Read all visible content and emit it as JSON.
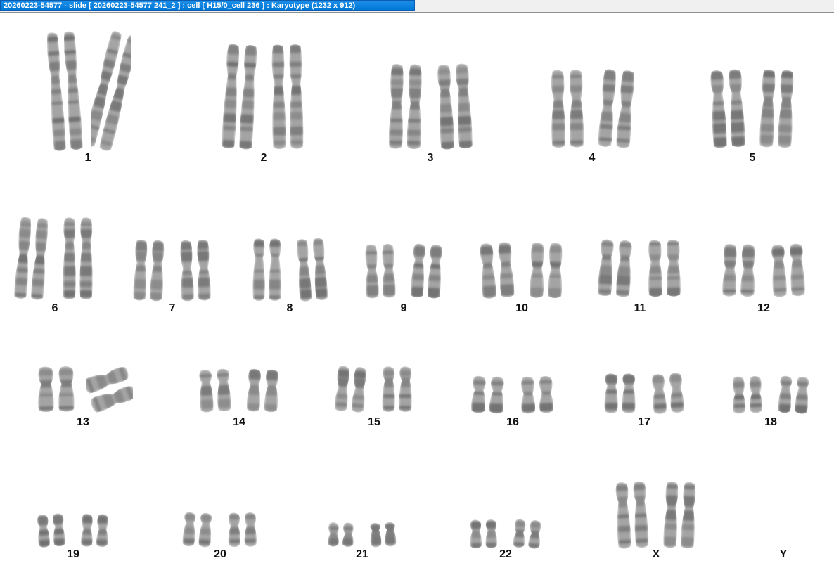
{
  "window": {
    "title": "20260223-54577 - slide [ 20260223-54577 241_2 ] : cell [ H15/0_cell 236 ] : Karyotype  (1232 x 912)"
  },
  "karyotype": {
    "pairs": [
      {
        "label": "1",
        "count": 2
      },
      {
        "label": "2",
        "count": 2
      },
      {
        "label": "3",
        "count": 2
      },
      {
        "label": "4",
        "count": 2
      },
      {
        "label": "5",
        "count": 2
      },
      {
        "label": "6",
        "count": 2
      },
      {
        "label": "7",
        "count": 2
      },
      {
        "label": "8",
        "count": 2
      },
      {
        "label": "9",
        "count": 2
      },
      {
        "label": "10",
        "count": 2
      },
      {
        "label": "11",
        "count": 2
      },
      {
        "label": "12",
        "count": 2
      },
      {
        "label": "13",
        "count": 2
      },
      {
        "label": "14",
        "count": 2
      },
      {
        "label": "15",
        "count": 2
      },
      {
        "label": "16",
        "count": 2
      },
      {
        "label": "17",
        "count": 2
      },
      {
        "label": "18",
        "count": 2
      },
      {
        "label": "19",
        "count": 2
      },
      {
        "label": "20",
        "count": 2
      },
      {
        "label": "21",
        "count": 2
      },
      {
        "label": "22",
        "count": 2
      },
      {
        "label": "X",
        "count": 2
      },
      {
        "label": "Y",
        "count": 0
      }
    ]
  },
  "colors": {
    "chromatin": "#5a5a5a",
    "band_dark": "#3a3a3a",
    "titlebar_tab": "#0078d7"
  }
}
